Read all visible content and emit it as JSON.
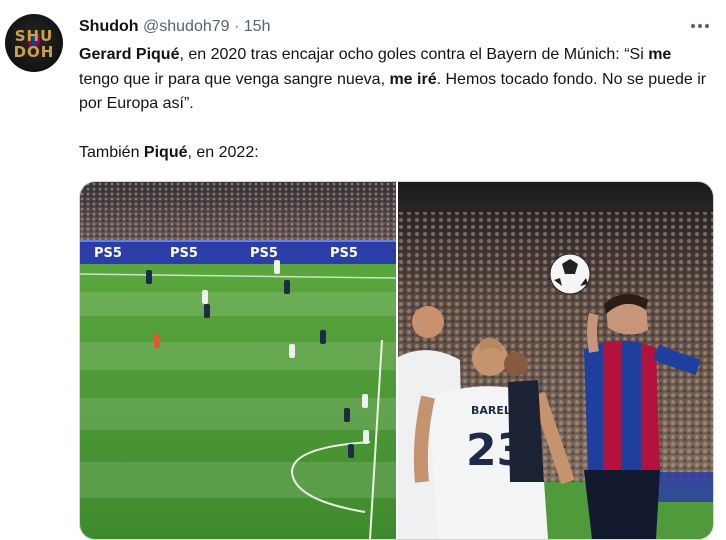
{
  "tweet": {
    "author": {
      "display_name": "Shudoh",
      "handle": "@shudoh79",
      "avatar_text": [
        "SHU",
        "DOH"
      ]
    },
    "separator": "·",
    "time": "15h",
    "more_icon": "more-horizontal-icon",
    "text": {
      "p1": [
        {
          "t": "Gerard Piqué",
          "b": true
        },
        {
          "t": ", en 2020 tras encajar ocho goles contra el Bayern de Múnich: “Si ",
          "b": false
        },
        {
          "t": "me",
          "b": true
        },
        {
          "t": " tengo que ir para que venga sangre nueva, ",
          "b": false
        },
        {
          "t": "me iré",
          "b": true
        },
        {
          "t": ". Hemos tocado fondo. No se puede ir por Europa así”.",
          "b": false
        }
      ],
      "p2": [
        {
          "t": "También ",
          "b": false
        },
        {
          "t": "Piqué",
          "b": true
        },
        {
          "t": ", en 2022:",
          "b": false
        }
      ]
    },
    "media": {
      "left_ads": [
        "PS5",
        "PS5",
        "PS5",
        "PS5"
      ],
      "right_jersey_name": "BARELLA",
      "right_jersey_number": "23"
    }
  },
  "colors": {
    "text": "#0f1419",
    "secondary": "#536471",
    "border": "#cfd9de",
    "pitch": "#4f9a3a",
    "ad_board": "#2b3ea8",
    "barca_blue": "#1f3f9e",
    "barca_red": "#b3123c"
  }
}
